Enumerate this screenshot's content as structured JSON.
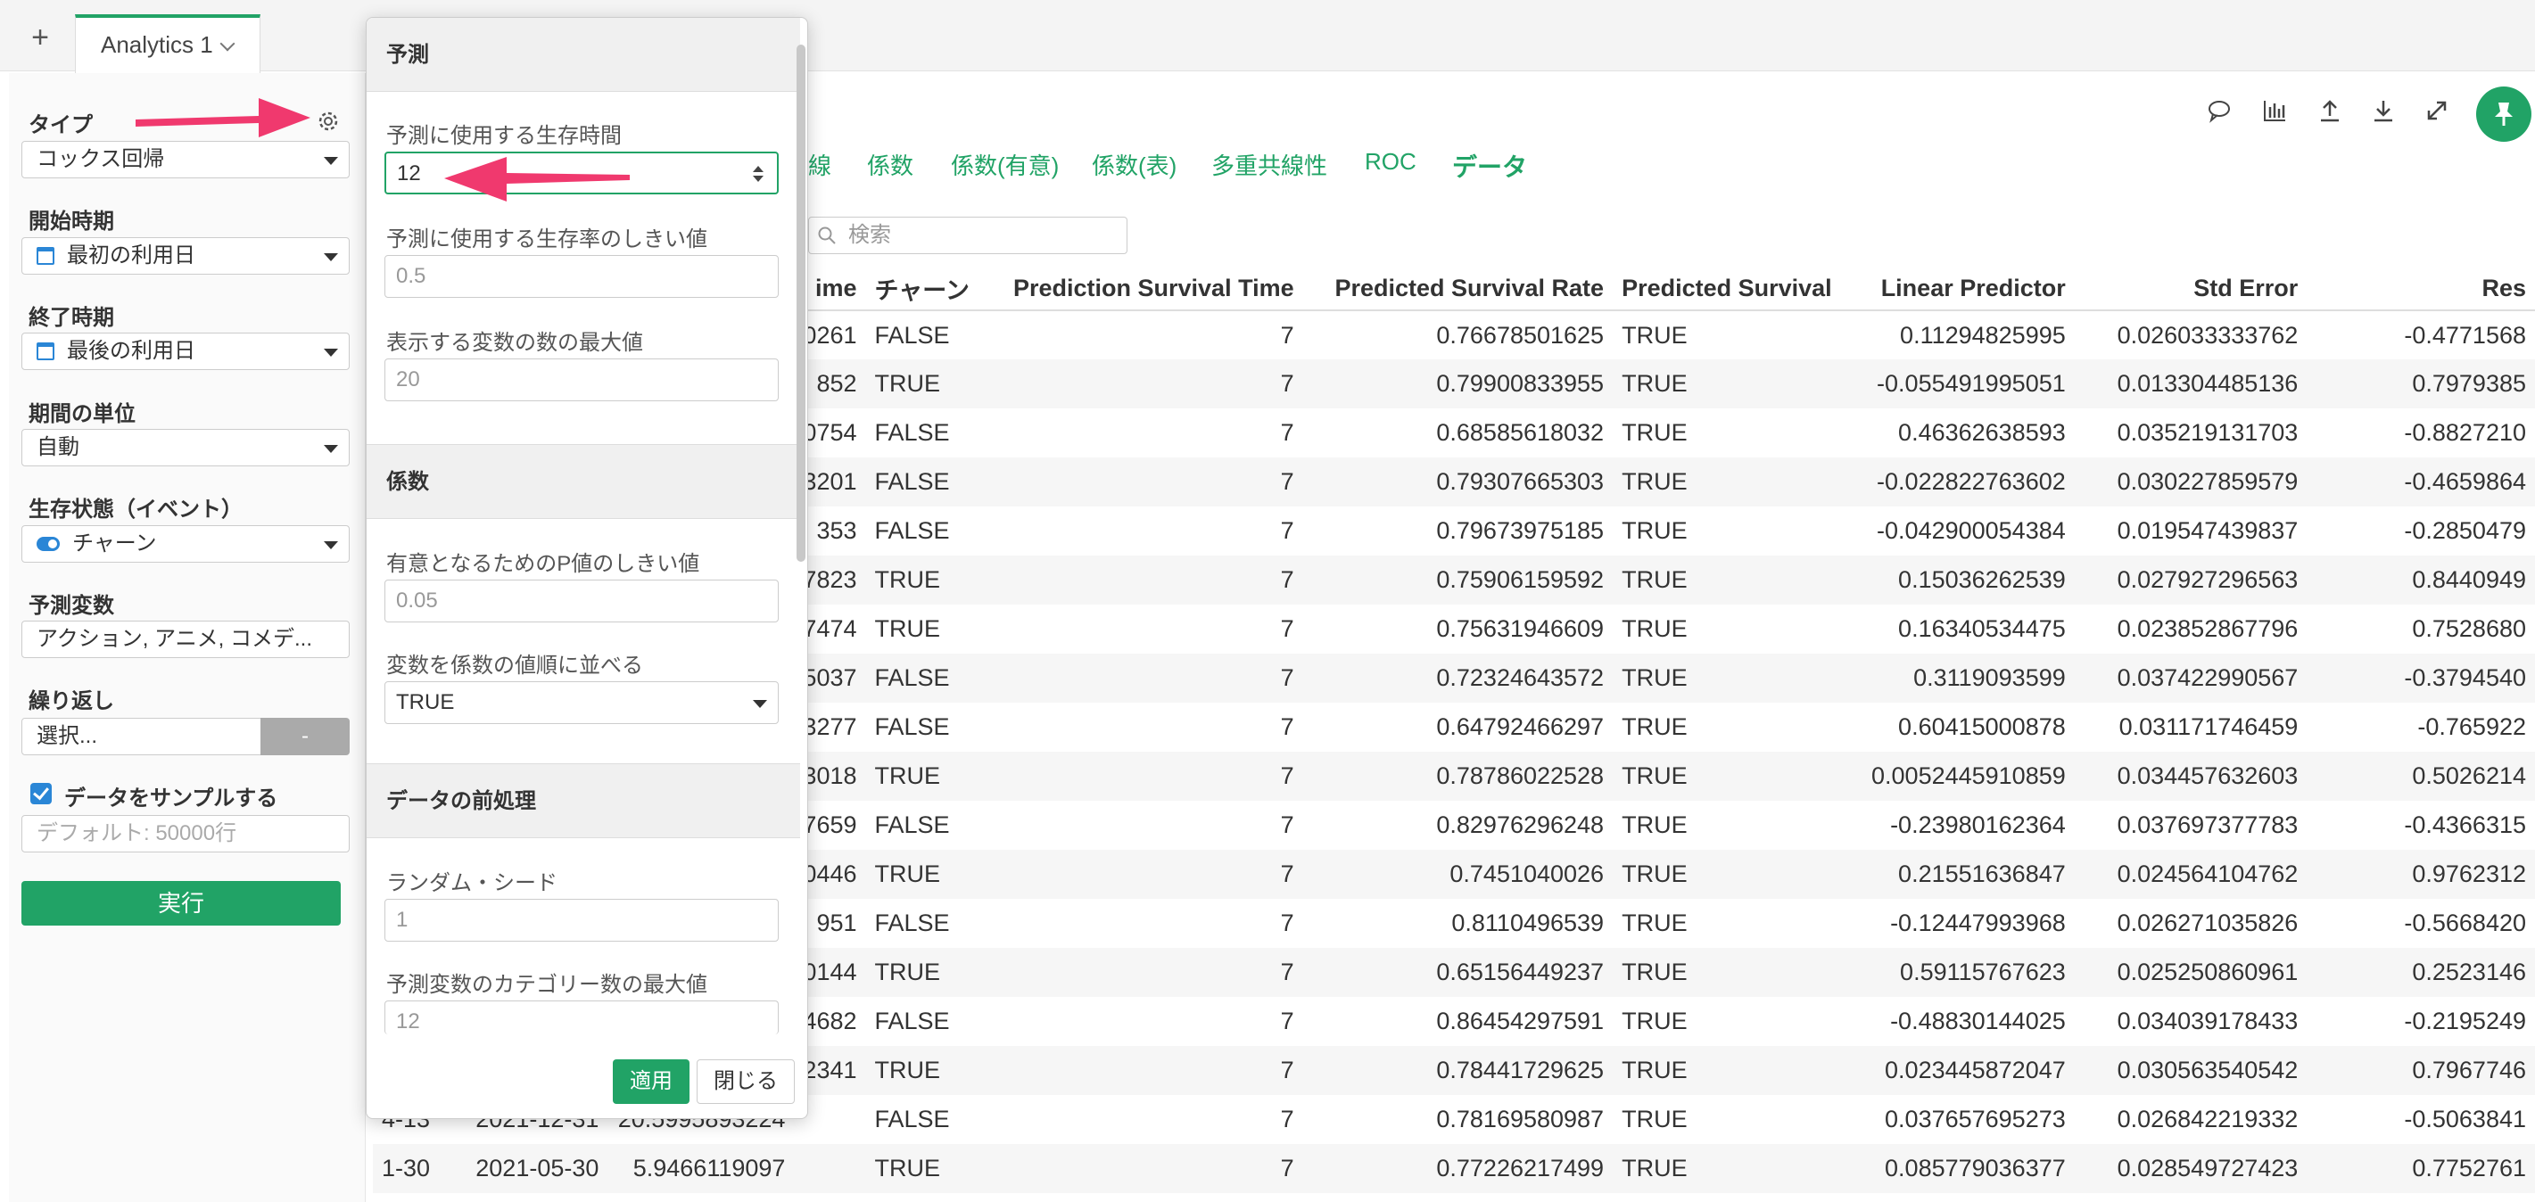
{
  "tabs": {
    "add": "+",
    "active_tab": "Analytics 1"
  },
  "sidebar": {
    "type_label": "タイプ",
    "type_value": "コックス回帰",
    "start_label": "開始時期",
    "start_value": "最初の利用日",
    "end_label": "終了時期",
    "end_value": "最後の利用日",
    "unit_label": "期間の単位",
    "unit_value": "自動",
    "status_label": "生存状態（イベント）",
    "status_value": "チャーン",
    "predictors_label": "予測変数",
    "predictors_value": "アクション, アニメ, コメデ...",
    "repeat_label": "繰り返し",
    "repeat_value": "選択...",
    "repeat_minus": "-",
    "sample_label": "データをサンプルする",
    "sample_placeholder": "デフォルト: 50000行",
    "run_label": "実行"
  },
  "main": {
    "view_tabs": [
      "線",
      "係数",
      "係数(有意)",
      "係数(表)",
      "多重共線性",
      "ROC",
      "データ"
    ],
    "search_placeholder": "検索",
    "columns": [
      "ime",
      "チャーン",
      "Prediction Survival Time",
      "Predicted Survival Rate",
      "Predicted Survival",
      "Linear Predictor",
      "Std Error",
      "Res"
    ],
    "rows": [
      [
        "",
        "",
        "",
        "0261",
        "FALSE",
        "7",
        "0.76678501625",
        "TRUE",
        "0.11294825995",
        "0.026033333762",
        "-0.4771568"
      ],
      [
        "",
        "",
        "",
        "852",
        "TRUE",
        "7",
        "0.79900833955",
        "TRUE",
        "-0.055491995051",
        "0.013304485136",
        "0.7979385"
      ],
      [
        "",
        "",
        "",
        "0754",
        "FALSE",
        "7",
        "0.68585618032",
        "TRUE",
        "0.46362638593",
        "0.035219131703",
        "-0.8827210"
      ],
      [
        "",
        "",
        "",
        "3201",
        "FALSE",
        "7",
        "0.79307665303",
        "TRUE",
        "-0.022822763602",
        "0.030227859579",
        "-0.4659864"
      ],
      [
        "",
        "",
        "",
        "353",
        "FALSE",
        "7",
        "0.79673975185",
        "TRUE",
        "-0.042900054384",
        "0.019547439837",
        "-0.2850479"
      ],
      [
        "",
        "",
        "",
        "7823",
        "TRUE",
        "7",
        "0.75906159592",
        "TRUE",
        "0.15036262539",
        "0.027927296563",
        "0.8440949"
      ],
      [
        "",
        "",
        "",
        "7474",
        "TRUE",
        "7",
        "0.75631946609",
        "TRUE",
        "0.16340534475",
        "0.023852867796",
        "0.7528680"
      ],
      [
        "",
        "",
        "",
        "5037",
        "FALSE",
        "7",
        "0.72324643572",
        "TRUE",
        "0.3119093599",
        "0.037422990567",
        "-0.3794540"
      ],
      [
        "",
        "",
        "",
        "3277",
        "FALSE",
        "7",
        "0.64792466297",
        "TRUE",
        "0.60415000878",
        "0.031171746459",
        "-0.765922"
      ],
      [
        "",
        "",
        "",
        "3018",
        "TRUE",
        "7",
        "0.78786022528",
        "TRUE",
        "0.0052445910859",
        "0.034457632603",
        "0.5026214"
      ],
      [
        "",
        "",
        "",
        "7659",
        "FALSE",
        "7",
        "0.82976296248",
        "TRUE",
        "-0.23980162364",
        "0.037697377783",
        "-0.4366315"
      ],
      [
        "",
        "",
        "",
        "0446",
        "TRUE",
        "7",
        "0.7451040026",
        "TRUE",
        "0.21551636847",
        "0.024564104762",
        "0.9762312"
      ],
      [
        "",
        "",
        "",
        "951",
        "FALSE",
        "7",
        "0.8110496539",
        "TRUE",
        "-0.12447993968",
        "0.026271035826",
        "-0.5668420"
      ],
      [
        "",
        "",
        "",
        "0144",
        "TRUE",
        "7",
        "0.65156449237",
        "TRUE",
        "0.59115767623",
        "0.025250860961",
        "0.2523146"
      ],
      [
        "",
        "",
        "",
        "4682",
        "FALSE",
        "7",
        "0.86454297591",
        "TRUE",
        "-0.48830144025",
        "0.034039178433",
        "-0.2195249"
      ],
      [
        "",
        "",
        "",
        "2341",
        "TRUE",
        "7",
        "0.78441729625",
        "TRUE",
        "0.023445872047",
        "0.030563540542",
        "0.7967746"
      ],
      [
        "4-13",
        "2021-12-31",
        "20.5995893224",
        "",
        "FALSE",
        "7",
        "0.78169580987",
        "TRUE",
        "0.037657695273",
        "0.026842219332",
        "-0.5063841"
      ],
      [
        "1-30",
        "2021-05-30",
        "5.9466119097",
        "",
        "TRUE",
        "7",
        "0.77226217499",
        "TRUE",
        "0.085779036377",
        "0.028549727423",
        "0.7752761"
      ]
    ]
  },
  "popover": {
    "section1_title": "予測",
    "survival_time_label": "予測に使用する生存時間",
    "survival_time_value": "12",
    "threshold_label": "予測に使用する生存率のしきい値",
    "threshold_placeholder": "0.5",
    "max_vars_label": "表示する変数の数の最大値",
    "max_vars_placeholder": "20",
    "section2_title": "係数",
    "pvalue_label": "有意となるためのP値のしきい値",
    "pvalue_placeholder": "0.05",
    "sort_label": "変数を係数の値順に並べる",
    "sort_value": "TRUE",
    "section3_title": "データの前処理",
    "seed_label": "ランダム・シード",
    "seed_placeholder": "1",
    "max_cat_label": "予測変数のカテゴリー数の最大値",
    "max_cat_placeholder": "12",
    "apply_label": "適用",
    "close_label": "閉じる"
  },
  "colors": {
    "accent": "#21a366",
    "annotation_arrow": "#f0396e",
    "toggle": "#2a86d6"
  }
}
